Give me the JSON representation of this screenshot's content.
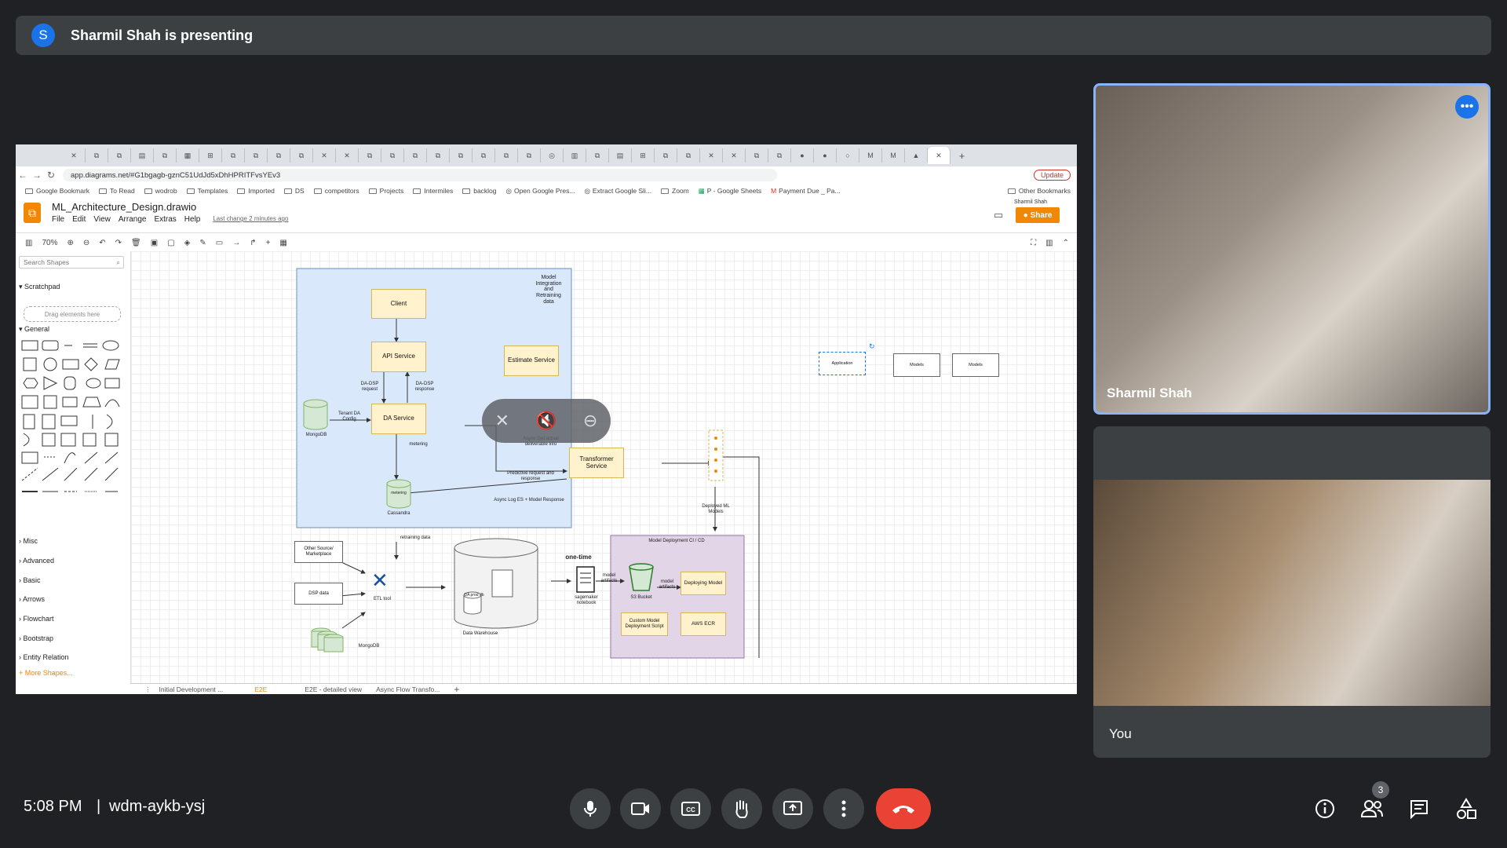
{
  "banner": {
    "avatar_letter": "S",
    "text": "Sharmil Shah is presenting"
  },
  "browser": {
    "url": "app.diagrams.net/#G1bgagb-gznC51UdJd5xDhHPRITFvsYEv3",
    "update_label": "Update",
    "bookmarks": [
      "Google Bookmark",
      "To Read",
      "wodrob",
      "Templates",
      "Imported",
      "DS",
      "competitors",
      "Projects",
      "Intermiles",
      "backlog",
      "Open Google Pres...",
      "Extract Google Sli...",
      "Zoom",
      "P - Google Sheets",
      "Payment Due _ Pa...",
      "Other Bookmarks"
    ]
  },
  "drawio": {
    "file_title": "ML_Architecture_Design.drawio",
    "menu": [
      "File",
      "Edit",
      "View",
      "Arrange",
      "Extras",
      "Help"
    ],
    "last_change": "Last change 2 minutes ago",
    "share_label": "Share",
    "user": "Sharmil Shah",
    "zoom": "70%",
    "search_placeholder": "Search Shapes",
    "scratchpad": "Scratchpad",
    "drag_hint": "Drag elements here",
    "general": "General",
    "sections": [
      "Misc",
      "Advanced",
      "Basic",
      "Arrows",
      "Flowchart",
      "Bootstrap",
      "Entity Relation"
    ],
    "more_shapes": "+ More Shapes...",
    "pages": [
      "Initial Development ...",
      "E2E",
      "E2E - detailed view",
      "Async Flow Transfo..."
    ],
    "diagram": {
      "title": "Model Integration and Retraining data",
      "client": "Client",
      "api": "API Service",
      "da": "DA Service",
      "estimate": "Estimate Service",
      "transformer": "Transformer Service",
      "mongodb": "MongoDB",
      "tenant": "Tenant DA Config",
      "metering_lbl": "metering",
      "cassandra": "Cassandra",
      "dadsp_req": "DA-DSP request",
      "dadsp_resp": "DA-DSP response",
      "async_get": "Async Get actual deliverable info",
      "predictive": "Predictive request and response",
      "async_log": "Async Log ES + Model Response",
      "deployed": "Deployed ML Models",
      "retraining": "retraining data",
      "other_source": "Other Source/ Marketplace",
      "dsp": "DSP data",
      "etl": "ETL tool",
      "data_wh": "Data Warehouse",
      "da_prod": "DA prod db",
      "one_time": "one-time",
      "sagemaker": "sagemaker notebook",
      "model_artifacts": "model artifacts",
      "s3": "S3 Bucket",
      "deploy_title": "Model Deployment CI / CD",
      "deploying": "Deploying Model",
      "custom": "Custom Model Deployment Script",
      "aws_ecr": "AWS ECR",
      "mongodb2": "MongoDB",
      "application": "Application",
      "models1": "Models",
      "models2": "Models"
    }
  },
  "tiles": {
    "presenter_name": "Sharmil Shah",
    "self_name": "You"
  },
  "bottom": {
    "time": "5:08 PM",
    "separator": "|",
    "meeting_code": "wdm-aykb-ysj",
    "participants": "3"
  }
}
